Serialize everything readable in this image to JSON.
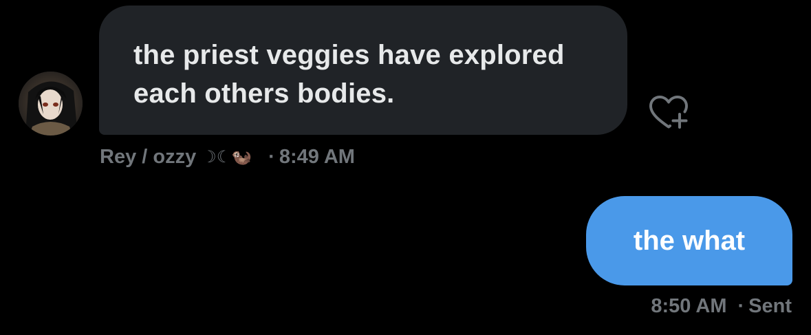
{
  "incoming": {
    "text": "the priest veggies have explored each others bodies.",
    "sender": "Rey / ozzy",
    "sender_emoji": "☽☾🦦",
    "time": "8:49 AM"
  },
  "outgoing": {
    "text": "the what",
    "time": "8:50 AM",
    "status": "Sent"
  },
  "separator": "·",
  "icons": {
    "avatar": "user-avatar",
    "react": "heart-plus-icon"
  },
  "colors": {
    "background": "#000000",
    "incoming_bubble": "#202327",
    "outgoing_bubble": "#4a99e9",
    "meta_text": "#71767b",
    "message_text": "#e7e9ea"
  }
}
